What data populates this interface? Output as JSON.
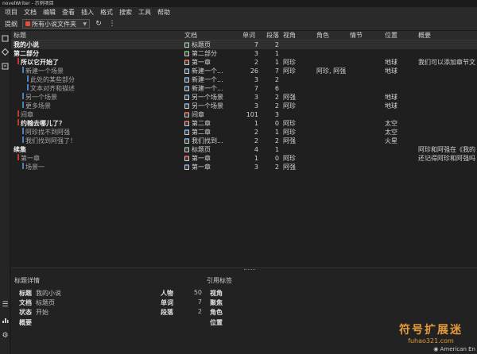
{
  "window": {
    "title": "novelWriter - 示例项目"
  },
  "menu": [
    "项目",
    "文档",
    "编辑",
    "查看",
    "插入",
    "格式",
    "搜索",
    "工具",
    "帮助"
  ],
  "toolbar": {
    "outline_label": "提纲",
    "filter_label": "所有小说文件夹",
    "filter_color": "#e74c3c",
    "refresh_icon": "refresh-icon",
    "more_icon": "more-icon"
  },
  "columns": {
    "title": "标题",
    "doc": "文档",
    "words": "单词",
    "paras": "段落",
    "pov": "视角",
    "chars": "角色",
    "plot": "情节",
    "location": "位置",
    "synopsis": "概要"
  },
  "rows": [
    {
      "title": "我的小说",
      "doc": "标题页",
      "words": "7",
      "paras": "2",
      "pov": "",
      "chars": "",
      "location": "",
      "synopsis": "",
      "bar": "",
      "icon": "gr",
      "indent": 0,
      "bold": true,
      "selected": true
    },
    {
      "title": "第二部分",
      "doc": "第二部分",
      "words": "3",
      "paras": "1",
      "pov": "",
      "chars": "",
      "location": "",
      "synopsis": "",
      "bar": "",
      "icon": "gr",
      "indent": 0,
      "bold": true,
      "selected": false
    },
    {
      "title": "所以它开始了",
      "doc": "第一章",
      "words": "2",
      "paras": "1",
      "pov": "阿珍",
      "chars": "",
      "location": "地球",
      "synopsis": "我们可以添加章节文",
      "bar": "#c0392b",
      "icon": "rd",
      "indent": 1,
      "bold": true,
      "selected": false
    },
    {
      "title": "新建一个场景",
      "doc": "新建一个...",
      "words": "26",
      "paras": "7",
      "pov": "阿珍",
      "chars": "阿珍, 阿强",
      "location": "地球",
      "synopsis": "",
      "bar": "#4a7fc0",
      "icon": "bl",
      "indent": 2,
      "bold": false,
      "selected": false
    },
    {
      "title": "此处的某些部分",
      "doc": "新建一个...",
      "words": "3",
      "paras": "2",
      "pov": "",
      "chars": "",
      "location": "",
      "synopsis": "",
      "bar": "#4a7fc0",
      "icon": "bl",
      "indent": 3,
      "bold": false,
      "selected": false
    },
    {
      "title": "文本对齐和描述",
      "doc": "新建一个...",
      "words": "7",
      "paras": "6",
      "pov": "",
      "chars": "",
      "location": "",
      "synopsis": "",
      "bar": "#4a7fc0",
      "icon": "bl",
      "indent": 3,
      "bold": false,
      "selected": false
    },
    {
      "title": "另一个场景",
      "doc": "另一个场景",
      "words": "3",
      "paras": "2",
      "pov": "阿强",
      "chars": "",
      "location": "地球",
      "synopsis": "",
      "bar": "#4a7fc0",
      "icon": "bl",
      "indent": 2,
      "bold": false,
      "selected": false
    },
    {
      "title": "更多场景",
      "doc": "另一个场景",
      "words": "3",
      "paras": "2",
      "pov": "阿珍",
      "chars": "",
      "location": "地球",
      "synopsis": "",
      "bar": "#4a7fc0",
      "icon": "bl",
      "indent": 2,
      "bold": false,
      "selected": false
    },
    {
      "title": "间章",
      "doc": "间章",
      "words": "101",
      "paras": "3",
      "pov": "",
      "chars": "",
      "location": "",
      "synopsis": "",
      "bar": "#c0392b",
      "icon": "rd",
      "indent": 1,
      "bold": false,
      "selected": false
    },
    {
      "title": "约翰去哪儿了？",
      "doc": "第二章",
      "words": "1",
      "paras": "0",
      "pov": "阿珍",
      "chars": "",
      "location": "太空",
      "synopsis": "",
      "bar": "#c0392b",
      "icon": "rd",
      "indent": 1,
      "bold": true,
      "selected": false
    },
    {
      "title": "阿珍找不到阿强",
      "doc": "第二章",
      "words": "2",
      "paras": "1",
      "pov": "阿珍",
      "chars": "",
      "location": "太空",
      "synopsis": "",
      "bar": "#4a7fc0",
      "icon": "bl",
      "indent": 2,
      "bold": false,
      "selected": false
    },
    {
      "title": "我们找到阿强了！",
      "doc": "我们找到...",
      "words": "2",
      "paras": "2",
      "pov": "阿强",
      "chars": "",
      "location": "火星",
      "synopsis": "",
      "bar": "#4a7fc0",
      "icon": "bl",
      "indent": 2,
      "bold": false,
      "selected": false
    },
    {
      "title": "续集",
      "doc": "标题页",
      "words": "4",
      "paras": "1",
      "pov": "",
      "chars": "",
      "location": "",
      "synopsis": "阿珍和阿强在《我的",
      "bar": "",
      "icon": "gr",
      "indent": 0,
      "bold": true,
      "selected": false
    },
    {
      "title": "第一章",
      "doc": "第一章",
      "words": "1",
      "paras": "0",
      "pov": "阿珍",
      "chars": "",
      "location": "",
      "synopsis": "还记得阿珍和阿强吗",
      "bar": "#c0392b",
      "icon": "rd",
      "indent": 1,
      "bold": false,
      "selected": false
    },
    {
      "title": "场景一",
      "doc": "第一章",
      "words": "3",
      "paras": "2",
      "pov": "阿强",
      "chars": "",
      "location": "",
      "synopsis": "",
      "bar": "#4a7fc0",
      "icon": "bl",
      "indent": 2,
      "bold": false,
      "selected": false
    }
  ],
  "details": {
    "header": "标题详情",
    "title_label": "标题",
    "title_value": "我的小说",
    "doc_label": "文档",
    "doc_value": "标题页",
    "status_label": "状态",
    "status_value": "开始",
    "synopsis_label": "概要",
    "chars_label": "人物",
    "chars_value": "50",
    "words_label": "单词",
    "words_value": "7",
    "paras_label": "段落",
    "paras_value": "2"
  },
  "tags": {
    "header": "引用标签",
    "items": [
      "视角",
      "聚焦",
      "角色",
      "位置"
    ]
  },
  "watermark": {
    "line1": "符号扩展迷",
    "line2": "fuhao321.com"
  },
  "status": {
    "language": "American En"
  },
  "sidebar_icons": [
    "project-tree-icon",
    "novel-tree-icon",
    "outline-icon",
    "list-icon",
    "stats-icon",
    "settings-icon"
  ]
}
